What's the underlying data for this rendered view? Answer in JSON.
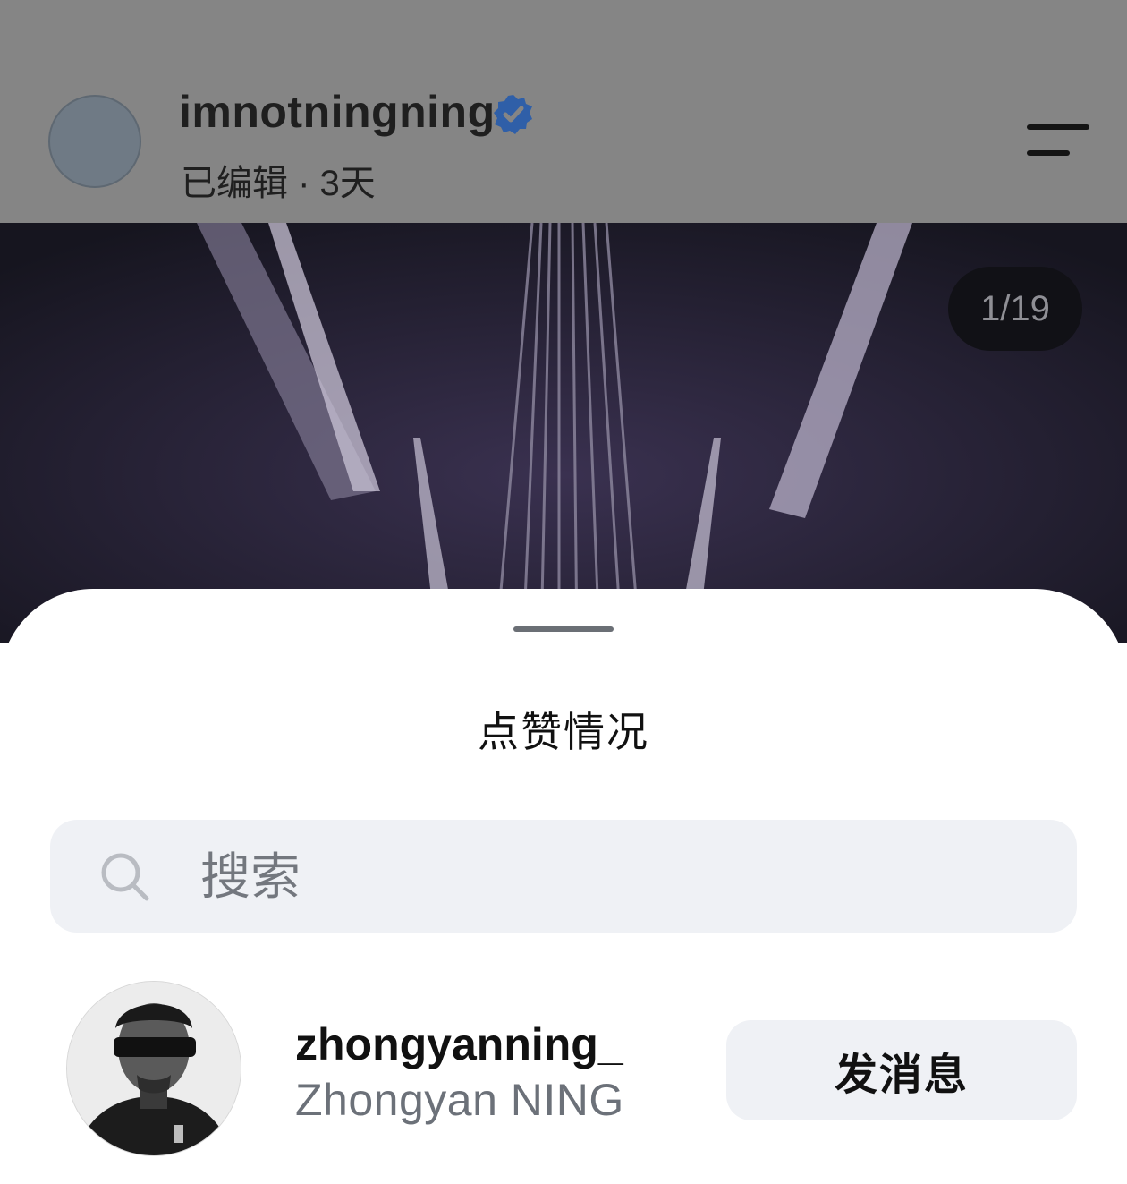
{
  "post": {
    "username": "imnotningning",
    "meta": "已编辑 · 3天",
    "verified": true,
    "image_counter": "1/19"
  },
  "likes_sheet": {
    "title": "点赞情况",
    "search": {
      "placeholder": "搜索",
      "value": ""
    },
    "users": [
      {
        "username": "zhongyanning_",
        "full_name": "Zhongyan NING",
        "action_label": "发消息"
      }
    ]
  },
  "icons": [
    "verified-badge-icon",
    "menu-icon",
    "search-icon"
  ],
  "colors": {
    "overlay": "#858585",
    "verified_blue": "#2f5fa8",
    "sheet_bg": "#ffffff",
    "input_bg": "#eff1f5",
    "secondary_text": "#6c7179"
  }
}
